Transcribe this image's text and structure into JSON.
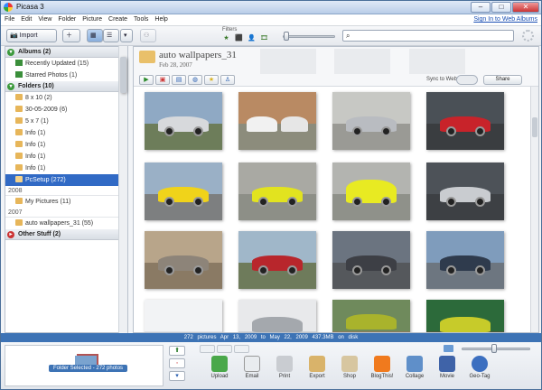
{
  "window": {
    "title": "Picasa 3",
    "buttons": {
      "minimize": "–",
      "maximize": "□",
      "close": "✕"
    }
  },
  "menu": {
    "items": [
      "File",
      "Edit",
      "View",
      "Folder",
      "Picture",
      "Create",
      "Tools",
      "Help"
    ],
    "signin": "Sign In to Web Albums"
  },
  "toolbar": {
    "import_label": "Import",
    "filters_label": "Filters",
    "filter_icons": [
      "★",
      "⬛",
      "👤",
      "🎞"
    ]
  },
  "sidebar": {
    "albums_header": "Albums (2)",
    "albums": [
      "Recently Updated (15)",
      "Starred Photos (1)"
    ],
    "folders_header": "Folders (10)",
    "folders": [
      "8 x 10 (2)",
      "30-05-2009 (6)",
      "5 x 7 (1)",
      "Info (1)",
      "Info (1)",
      "Info (1)",
      "Info (1)"
    ],
    "selected_folder": "PcSetup (272)",
    "year_2008": "2008",
    "folders_2008": [
      "My Pictures (11)"
    ],
    "year_2007": "2007",
    "folders_2007": [
      "auto wallpapers_31 (55)"
    ],
    "other_header": "Other Stuff (2)"
  },
  "album": {
    "title": "auto wallpapers_31",
    "date": "Feb 28, 2007",
    "sync_label": "Sync to Web",
    "share_label": "Share"
  },
  "status": {
    "text": "272 pictures   Apr 13, 2009 to May 22, 2009   437.3MB on disk"
  },
  "tray": {
    "held_label": "Folder Selected - 272 photos",
    "actions": [
      "Upload",
      "Email",
      "Print",
      "Export",
      "Shop",
      "BlogThis!",
      "Collage",
      "Movie",
      "Geo-Tag"
    ]
  },
  "colors": {
    "accent": "#316ac5",
    "statusbar": "#3d73b5"
  }
}
